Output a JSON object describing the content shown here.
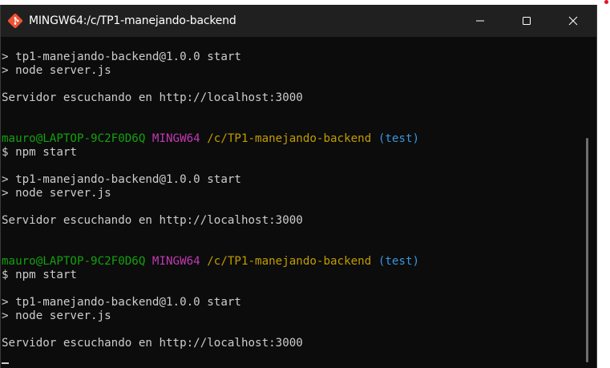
{
  "window": {
    "title": "MINGW64:/c/TP1-manejando-backend"
  },
  "icons": {
    "app": "git-bash-icon",
    "minimize": "minimize-icon",
    "maximize": "maximize-icon",
    "close": "close-icon"
  },
  "colors": {
    "user": "#13a10e",
    "env": "#c239b3",
    "path": "#c19c00",
    "branch": "#3a96dd"
  },
  "terminal": {
    "lines": [
      {
        "type": "blank"
      },
      {
        "type": "text",
        "text": "> tp1-manejando-backend@1.0.0 start"
      },
      {
        "type": "text",
        "text": "> node server.js"
      },
      {
        "type": "blank"
      },
      {
        "type": "text",
        "text": "Servidor escuchando en http://localhost:3000"
      },
      {
        "type": "blank"
      },
      {
        "type": "blank"
      },
      {
        "type": "prompt",
        "user": "mauro@LAPTOP-9C2F0D6Q",
        "env": "MINGW64",
        "path": "/c/TP1-manejando-backend",
        "branch": "(test)"
      },
      {
        "type": "text",
        "text": "$ npm start"
      },
      {
        "type": "blank"
      },
      {
        "type": "text",
        "text": "> tp1-manejando-backend@1.0.0 start"
      },
      {
        "type": "text",
        "text": "> node server.js"
      },
      {
        "type": "blank"
      },
      {
        "type": "text",
        "text": "Servidor escuchando en http://localhost:3000"
      },
      {
        "type": "blank"
      },
      {
        "type": "blank"
      },
      {
        "type": "prompt",
        "user": "mauro@LAPTOP-9C2F0D6Q",
        "env": "MINGW64",
        "path": "/c/TP1-manejando-backend",
        "branch": "(test)"
      },
      {
        "type": "text",
        "text": "$ npm start"
      },
      {
        "type": "blank"
      },
      {
        "type": "text",
        "text": "> tp1-manejando-backend@1.0.0 start"
      },
      {
        "type": "text",
        "text": "> node server.js"
      },
      {
        "type": "blank"
      },
      {
        "type": "text",
        "text": "Servidor escuchando en http://localhost:3000"
      },
      {
        "type": "cursor"
      }
    ]
  }
}
